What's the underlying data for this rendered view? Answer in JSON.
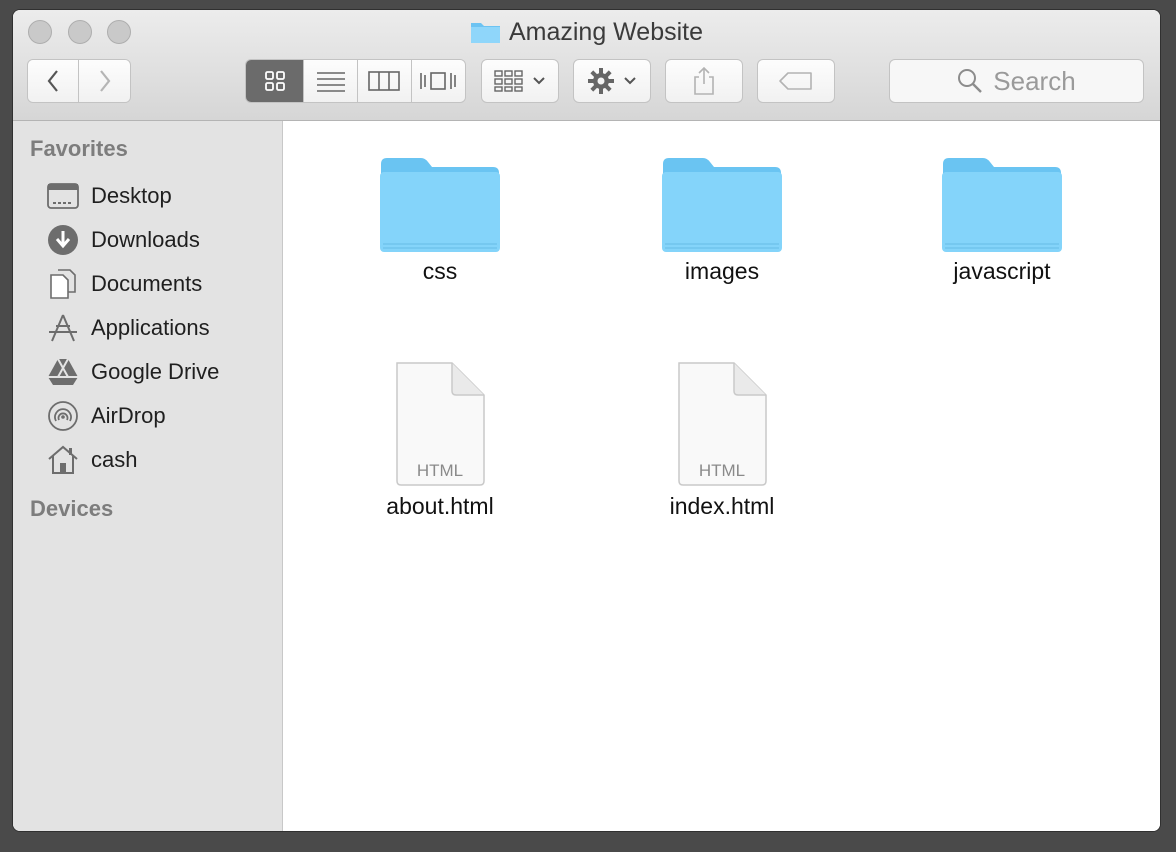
{
  "window": {
    "title": "Amazing Website"
  },
  "toolbar": {
    "search_placeholder": "Search"
  },
  "sidebar": {
    "favorites_label": "Favorites",
    "items": [
      {
        "label": "Desktop",
        "icon": "desktop-icon"
      },
      {
        "label": "Downloads",
        "icon": "download-icon"
      },
      {
        "label": "Documents",
        "icon": "documents-icon"
      },
      {
        "label": "Applications",
        "icon": "applications-icon"
      },
      {
        "label": "Google Drive",
        "icon": "google-drive-icon"
      },
      {
        "label": "AirDrop",
        "icon": "airdrop-icon"
      },
      {
        "label": "cash",
        "icon": "home-icon"
      }
    ],
    "devices_label": "Devices"
  },
  "files": [
    {
      "name": "css",
      "kind": "folder"
    },
    {
      "name": "images",
      "kind": "folder"
    },
    {
      "name": "javascript",
      "kind": "folder"
    },
    {
      "name": "about.html",
      "kind": "file",
      "badge": "HTML"
    },
    {
      "name": "index.html",
      "kind": "file",
      "badge": "HTML"
    }
  ],
  "colors": {
    "folder": "#7fd0f7",
    "selected_view": "#6b6b6b",
    "sidebar_bg": "#e3e3e3"
  }
}
